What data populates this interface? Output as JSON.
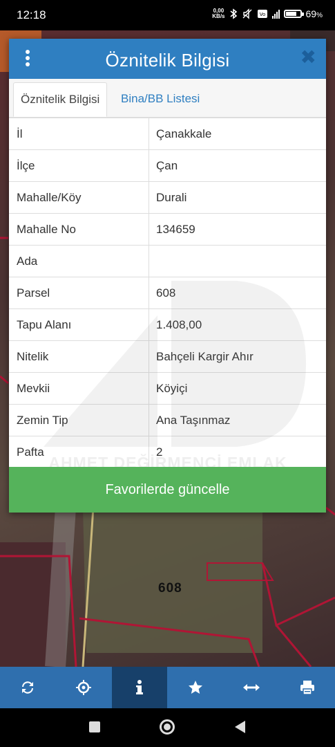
{
  "status_bar": {
    "time": "12:18",
    "net_speed": "0,00",
    "net_speed_unit": "KB/s",
    "battery_percent": "69",
    "battery_suffix": "%",
    "battery_level": 0.69
  },
  "dialog": {
    "title": "Öznitelik Bilgisi",
    "tabs": [
      {
        "label": "Öznitelik Bilgisi",
        "active": true
      },
      {
        "label": "Bina/BB Listesi",
        "active": false
      }
    ],
    "rows": [
      {
        "key": "İl",
        "value": "Çanakkale"
      },
      {
        "key": "İlçe",
        "value": "Çan"
      },
      {
        "key": "Mahalle/Köy",
        "value": "Durali"
      },
      {
        "key": "Mahalle No",
        "value": "134659"
      },
      {
        "key": "Ada",
        "value": ""
      },
      {
        "key": "Parsel",
        "value": "608"
      },
      {
        "key": "Tapu Alanı",
        "value": "1.408,00"
      },
      {
        "key": "Nitelik",
        "value": "Bahçeli Kargir Ahır"
      },
      {
        "key": "Mevkii",
        "value": "Köyiçi"
      },
      {
        "key": "Zemin Tip",
        "value": "Ana Taşınmaz"
      },
      {
        "key": "Pafta",
        "value": "2"
      }
    ],
    "favorite_button": "Favorilerde güncelle",
    "watermark_text": "AHMET DEĞİRMENCİ EMLAK"
  },
  "map": {
    "parcel_label": "608"
  },
  "toolbar": {
    "items": [
      {
        "icon": "refresh-icon",
        "active": false
      },
      {
        "icon": "locate-icon",
        "active": false
      },
      {
        "icon": "info-icon",
        "active": true
      },
      {
        "icon": "star-icon",
        "active": false
      },
      {
        "icon": "measure-icon",
        "active": false
      },
      {
        "icon": "print-icon",
        "active": false
      }
    ]
  },
  "colors": {
    "header": "#2f7fc1",
    "button": "#55b35b",
    "toolbar": "#2f6fae",
    "toolbar_active": "#17406a"
  }
}
